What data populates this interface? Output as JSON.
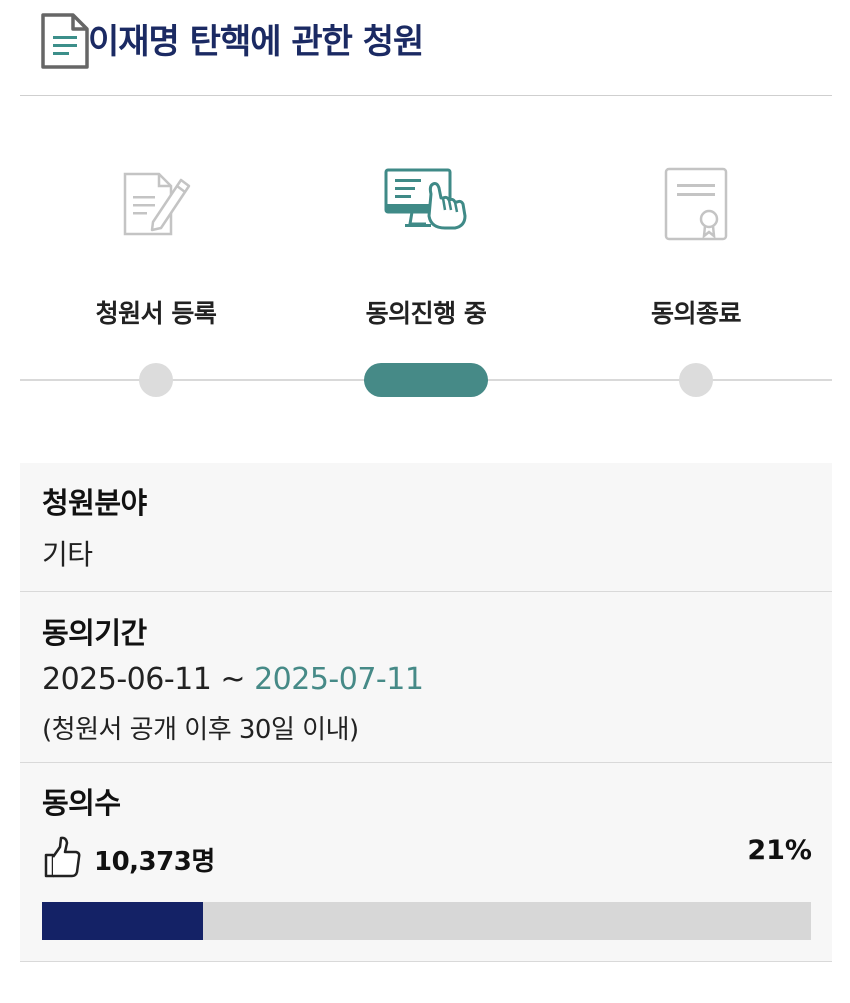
{
  "header": {
    "title": "이재명 탄핵에 관한 청원",
    "icon": "document-icon"
  },
  "steps": [
    {
      "label": "청원서 등록",
      "icon": "write-document-icon",
      "state": "done"
    },
    {
      "label": "동의진행 중",
      "icon": "monitor-click-icon",
      "state": "current"
    },
    {
      "label": "동의종료",
      "icon": "certificate-icon",
      "state": "pending"
    }
  ],
  "info": {
    "category": {
      "title": "청원분야",
      "value": "기타"
    },
    "period": {
      "title": "동의기간",
      "start": "2025-06-11",
      "separator": " ~ ",
      "end": "2025-07-11",
      "note": "(청원서 공개 이후 30일 이내)"
    },
    "agreements": {
      "title": "동의수",
      "count": "10,373명",
      "percent_label": "21%",
      "progress": 0.21,
      "icon": "thumbs-up-icon"
    }
  },
  "colors": {
    "title": "#1b2a63",
    "accent": "#468a87",
    "progress": "#142266"
  }
}
